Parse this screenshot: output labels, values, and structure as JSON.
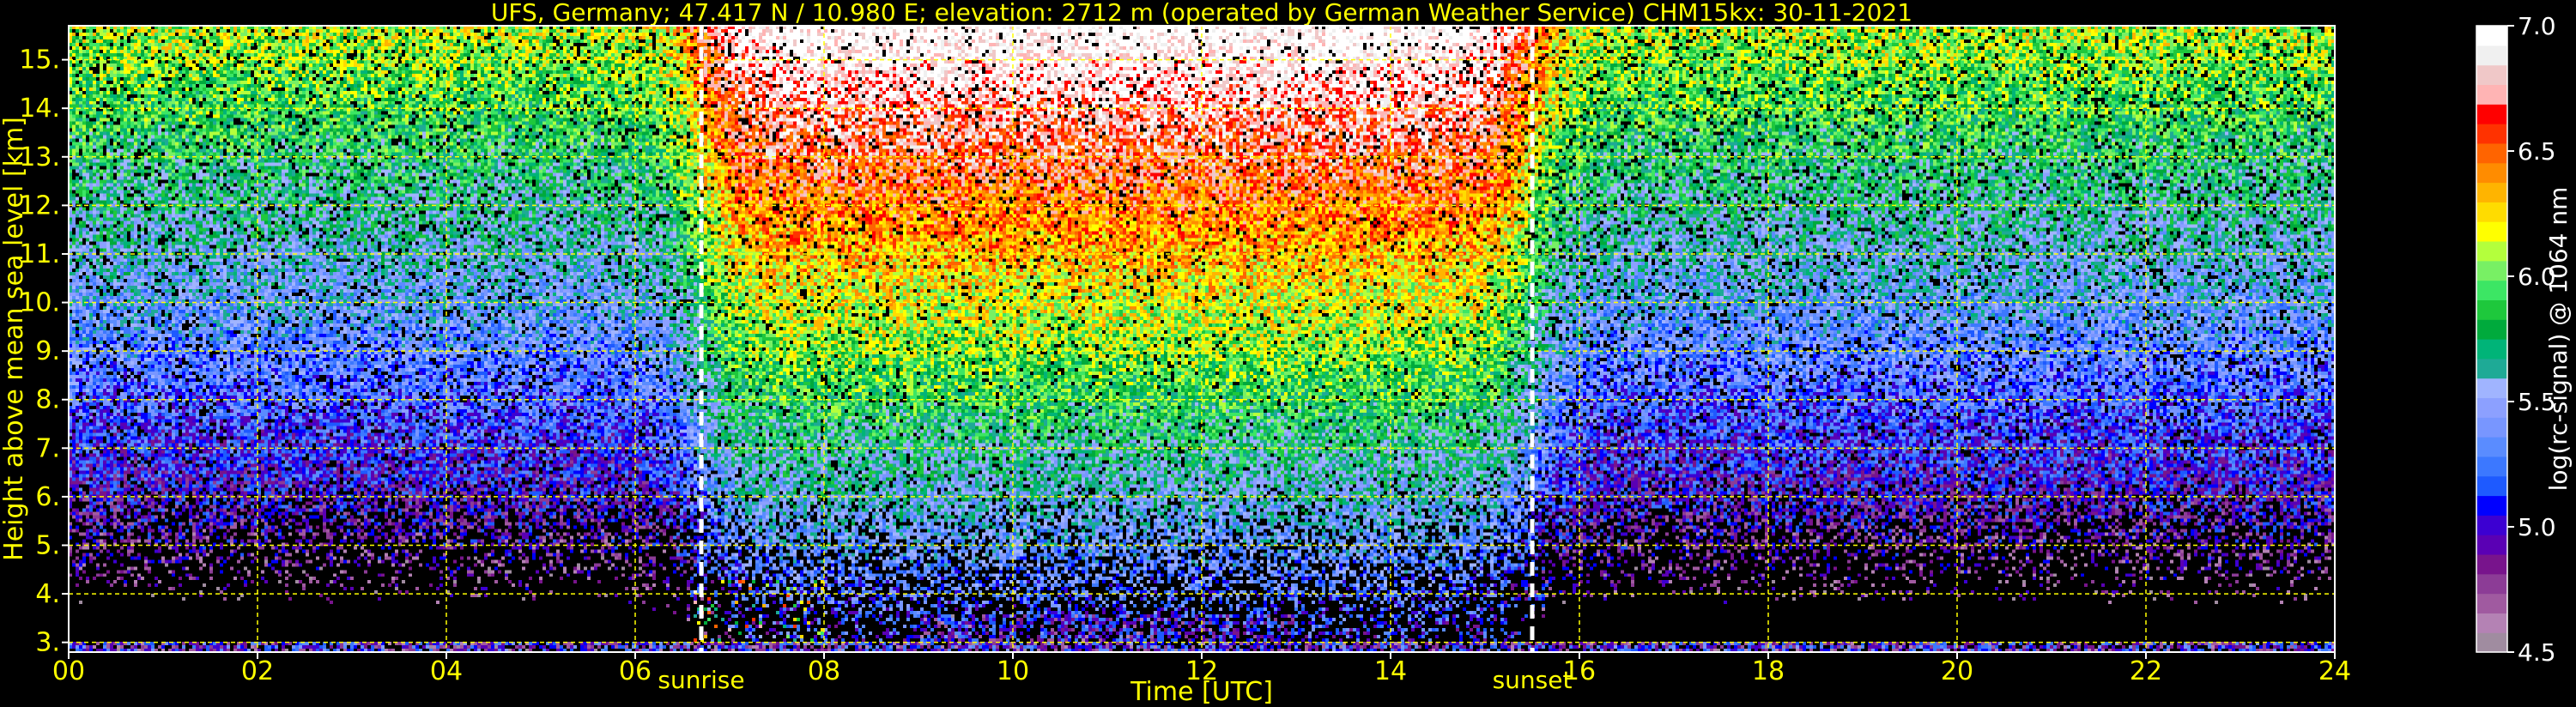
{
  "chart_data": {
    "type": "heatmap",
    "title": "UFS, Germany; 47.417 N / 10.980 E; elevation: 2712 m  (operated by German Weather Service)    CHM15kx: 30-11-2021",
    "xlabel": "Time [UTC]",
    "ylabel": "Height above mean sea level [km]",
    "xlim": [
      0,
      24
    ],
    "ylim": [
      2.8,
      15.7
    ],
    "x_ticks": [
      "00",
      "02",
      "04",
      "06",
      "08",
      "10",
      "12",
      "14",
      "16",
      "18",
      "20",
      "22",
      "24"
    ],
    "y_ticks": [
      "3.",
      "4.",
      "5.",
      "6.",
      "7.",
      "8.",
      "9.",
      "10.",
      "11.",
      "12.",
      "13.",
      "14.",
      "15."
    ],
    "grid": true,
    "grid_color": "#ffff00",
    "events": [
      {
        "label": "sunrise",
        "time": 6.7
      },
      {
        "label": "sunset",
        "time": 15.5
      }
    ],
    "colorbar": {
      "label": "log(rc-signal) @ 1064 nm",
      "range": [
        4.5,
        7.0
      ],
      "ticks": [
        "4.5",
        "5.0",
        "5.5",
        "6.0",
        "6.5",
        "7.0"
      ],
      "colors": [
        "#a08ca0",
        "#b482b4",
        "#a05aa0",
        "#8c3c96",
        "#78148c",
        "#5a00b4",
        "#3c00d2",
        "#0000ff",
        "#1e5aff",
        "#3c78ff",
        "#5a8cff",
        "#7896ff",
        "#8ca0ff",
        "#a0b4ff",
        "#1eaa96",
        "#00b478",
        "#00aa3c",
        "#1ec83c",
        "#3ce664",
        "#78f064",
        "#b4ff3c",
        "#ffff00",
        "#ffdc00",
        "#ffb400",
        "#ff8c00",
        "#ff6400",
        "#ff3200",
        "#ff0000",
        "#ffb4b4",
        "#f0c8c8",
        "#f0f0f0",
        "#ffffff"
      ]
    },
    "background_color": "#000000"
  }
}
